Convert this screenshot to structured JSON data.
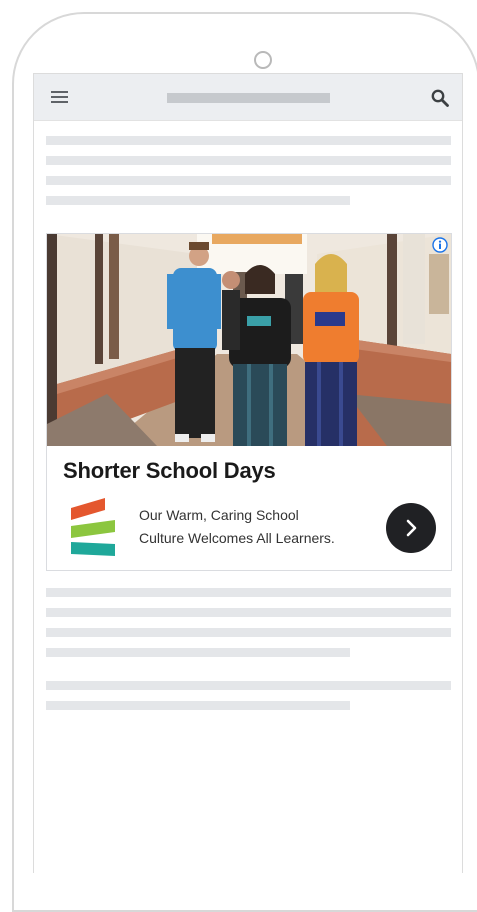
{
  "topbar": {
    "menu_icon": "hamburger-menu-icon",
    "search_icon": "search-icon"
  },
  "ad": {
    "info_icon": "info-icon",
    "headline": "Shorter School Days",
    "body_line1": "Our Warm, Caring School",
    "body_line2": "Culture Welcomes All Learners.",
    "cta_icon": "chevron-right-icon",
    "logo_colors": [
      "#e4572e",
      "#8cc63f",
      "#1fa89a"
    ]
  },
  "colors": {
    "frame": "#d8d8d8",
    "topbar": "#eceef1",
    "placeholder": "#e4e6e9",
    "cta": "#202124"
  }
}
